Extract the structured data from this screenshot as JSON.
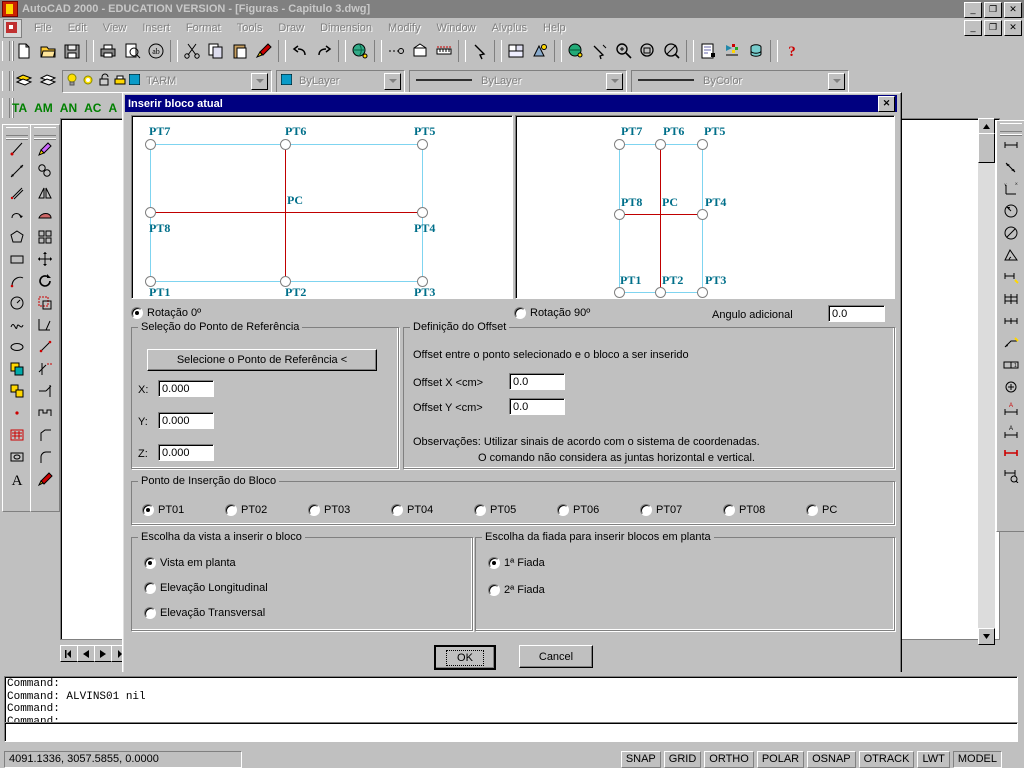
{
  "window": {
    "title": "AutoCAD 2000 - EDUCATION VERSION - [Figuras - Capitulo 3.dwg]",
    "app_icon": "autocad-icon",
    "minimize": "_",
    "maximize": "❐",
    "close": "✕"
  },
  "menubar": {
    "items": [
      {
        "label": "File",
        "accel": "F"
      },
      {
        "label": "Edit",
        "accel": "E"
      },
      {
        "label": "View",
        "accel": "V"
      },
      {
        "label": "Insert",
        "accel": "I"
      },
      {
        "label": "Format",
        "accel": "o"
      },
      {
        "label": "Tools",
        "accel": "T"
      },
      {
        "label": "Draw",
        "accel": "D"
      },
      {
        "label": "Dimension",
        "accel": "n"
      },
      {
        "label": "Modify",
        "accel": "M"
      },
      {
        "label": "Window",
        "accel": "W"
      },
      {
        "label": "Alvplus",
        "accel": "A"
      },
      {
        "label": "Help",
        "accel": "H"
      }
    ]
  },
  "standard_toolbar": {
    "buttons": [
      "new-file-icon",
      "open-folder-icon",
      "save-disk-icon",
      "print-icon",
      "print-preview-icon",
      "spellcheck-icon",
      "cut-scissors-icon",
      "copy-icon",
      "paste-icon",
      "match-properties-icon",
      "undo-icon",
      "redo-icon",
      "hyperlink-globe-icon",
      "distance-icon",
      "block-insert-icon",
      "measure-icon",
      "pan-realtime-icon",
      "named-views-icon",
      "render-icon",
      "ucs-icon",
      "3dorbit-icon",
      "zoom-window-icon",
      "zoom-previous-icon",
      "zoom-realtime-icon",
      "properties-icon",
      "designcenter-icon",
      "dbconnect-icon",
      "help-question-icon"
    ]
  },
  "object_properties_toolbar": {
    "layer_buttons": [
      "make-object-layer-icon",
      "layers-manager-icon"
    ],
    "layer_state_icons": [
      "lightbulb-on-icon",
      "sun-freeze-icon",
      "lock-open-icon",
      "plot-printer-icon",
      "color-swatch-icon"
    ],
    "layer_value": "TARM",
    "color_value": "ByLayer",
    "linetype_value": "ByLayer",
    "lineweight_value": "ByColor"
  },
  "custom_toolbar": {
    "items": [
      "TA",
      "AM",
      "AN",
      "AC",
      "A"
    ]
  },
  "draw_toolbar": {
    "buttons": [
      "line-icon",
      "construction-line-icon",
      "polyline-icon",
      "arc-polyline-icon",
      "polygon-icon",
      "rectangle-icon",
      "arc-icon",
      "circle-icon",
      "spline-icon",
      "ellipse-icon",
      "make-block-icon",
      "insert-block-icon",
      "point-icon",
      "hatch-icon",
      "region-icon",
      "multiline-text-icon"
    ]
  },
  "modify_toolbar": {
    "buttons": [
      "erase-icon",
      "copy-object-icon",
      "mirror-icon",
      "offset-icon",
      "array-icon",
      "move-icon",
      "rotate-icon",
      "scale-icon",
      "stretch-icon",
      "lengthen-icon",
      "trim-icon",
      "extend-icon",
      "break-icon",
      "chamfer-icon",
      "fillet-icon",
      "explode-icon"
    ]
  },
  "dimension_toolbar": {
    "buttons": [
      "linear-dimension-icon",
      "aligned-dimension-icon",
      "ordinate-dimension-icon",
      "radius-dimension-icon",
      "diameter-dimension-icon",
      "angular-dimension-icon",
      "baseline-dimension-icon",
      "continue-dimension-icon",
      "quick-dimension-icon",
      "leader-icon",
      "tolerance-icon",
      "center-mark-icon",
      "dimension-edit-icon",
      "dimension-text-edit-icon",
      "dimension-update-icon",
      "dimension-style-icon"
    ]
  },
  "dialog": {
    "title": "Inserir bloco atual",
    "close_label": "✕",
    "preview_plan": {
      "name": "plan-view-preview",
      "labels": [
        "PT7",
        "PT6",
        "PT5",
        "PC",
        "PT8",
        "PT4",
        "PT1",
        "PT2",
        "PT3"
      ]
    },
    "preview_elevation": {
      "name": "rotated-view-preview",
      "labels": [
        "PT7",
        "PT6",
        "PT5",
        "PT8",
        "PC",
        "PT4",
        "PT1",
        "PT2",
        "PT3"
      ]
    },
    "rotation": {
      "options": [
        {
          "label": "Rotação 0º",
          "selected": true
        },
        {
          "label": "Rotação 90º",
          "selected": false
        }
      ],
      "angle_label": "Angulo adicional",
      "angle_value": "0.0"
    },
    "reference_point": {
      "group_title": "Seleção do Ponto de Referência",
      "button_label": "Selecione o Ponto de Referência <",
      "fields": [
        {
          "label": "X:",
          "value": "0.000"
        },
        {
          "label": "Y:",
          "value": "0.000"
        },
        {
          "label": "Z:",
          "value": "0.000"
        }
      ]
    },
    "offset": {
      "group_title": "Definição do Offset",
      "description": "Offset entre o ponto selecionado e o bloco a ser inserido",
      "fields": [
        {
          "label": "Offset X <cm>",
          "value": "0.0"
        },
        {
          "label": "Offset Y <cm>",
          "value": "0.0"
        }
      ],
      "note_line1": "Observações: Utilizar sinais de acordo com o sistema de coordenadas.",
      "note_line2": "O comando não considera as juntas horizontal e vertical."
    },
    "insertion_point": {
      "group_title": "Ponto de Inserção do Bloco",
      "options": [
        {
          "label": "PT01",
          "selected": true
        },
        {
          "label": "PT02",
          "selected": false
        },
        {
          "label": "PT03",
          "selected": false
        },
        {
          "label": "PT04",
          "selected": false
        },
        {
          "label": "PT05",
          "selected": false
        },
        {
          "label": "PT06",
          "selected": false
        },
        {
          "label": "PT07",
          "selected": false
        },
        {
          "label": "PT08",
          "selected": false
        },
        {
          "label": "PC",
          "selected": false
        }
      ]
    },
    "view_choice": {
      "group_title": "Escolha da vista a inserir o bloco",
      "options": [
        {
          "label": "Vista em planta",
          "selected": true
        },
        {
          "label": "Elevação Longitudinal",
          "selected": false
        },
        {
          "label": "Elevação Transversal",
          "selected": false
        }
      ]
    },
    "course_choice": {
      "group_title": "Escolha da fiada para inserir blocos em planta",
      "options": [
        {
          "label": "1ª Fiada",
          "selected": true
        },
        {
          "label": "2ª Fiada",
          "selected": false
        }
      ]
    },
    "ok_label": "OK",
    "cancel_label": "Cancel"
  },
  "command_window": {
    "lines": [
      "Command:",
      "Command:  ALVINS01 nil",
      "Command:",
      "Command:"
    ],
    "input_value": ""
  },
  "statusbar": {
    "coords": "4091.1336, 3057.5855, 0.0000",
    "toggles": [
      {
        "label": "SNAP",
        "pressed": false
      },
      {
        "label": "GRID",
        "pressed": false
      },
      {
        "label": "ORTHO",
        "pressed": false
      },
      {
        "label": "POLAR",
        "pressed": false
      },
      {
        "label": "OSNAP",
        "pressed": false
      },
      {
        "label": "OTRACK",
        "pressed": false
      },
      {
        "label": "LWT",
        "pressed": false
      },
      {
        "label": "MODEL",
        "pressed": true
      }
    ]
  },
  "colors": {
    "desktop": "#c0c0c0",
    "titlebar_inactive": "#808080",
    "dialog_titlebar": "#000080",
    "preview_node": "#7fd4f0",
    "preview_axis": "#c00000",
    "preview_label": "#006f8a",
    "custom_toolbar_text": "#008000"
  }
}
